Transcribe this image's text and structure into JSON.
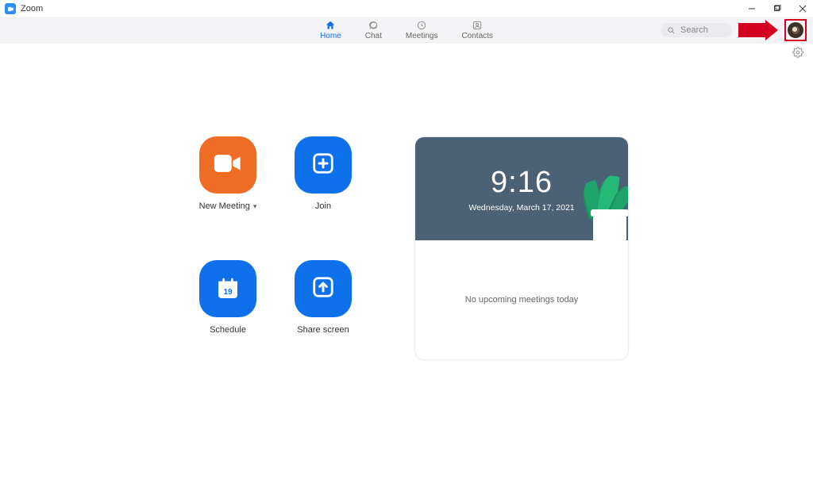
{
  "window": {
    "title": "Zoom"
  },
  "tabs": {
    "home": "Home",
    "chat": "Chat",
    "meetings": "Meetings",
    "contacts": "Contacts"
  },
  "search": {
    "placeholder": "Search"
  },
  "actions": {
    "new_meeting": "New Meeting",
    "join": "Join",
    "schedule": "Schedule",
    "share_screen": "Share screen",
    "schedule_day": "19"
  },
  "dashboard": {
    "time": "9:16",
    "date": "Wednesday, March 17, 2021",
    "no_meetings": "No upcoming meetings today"
  }
}
